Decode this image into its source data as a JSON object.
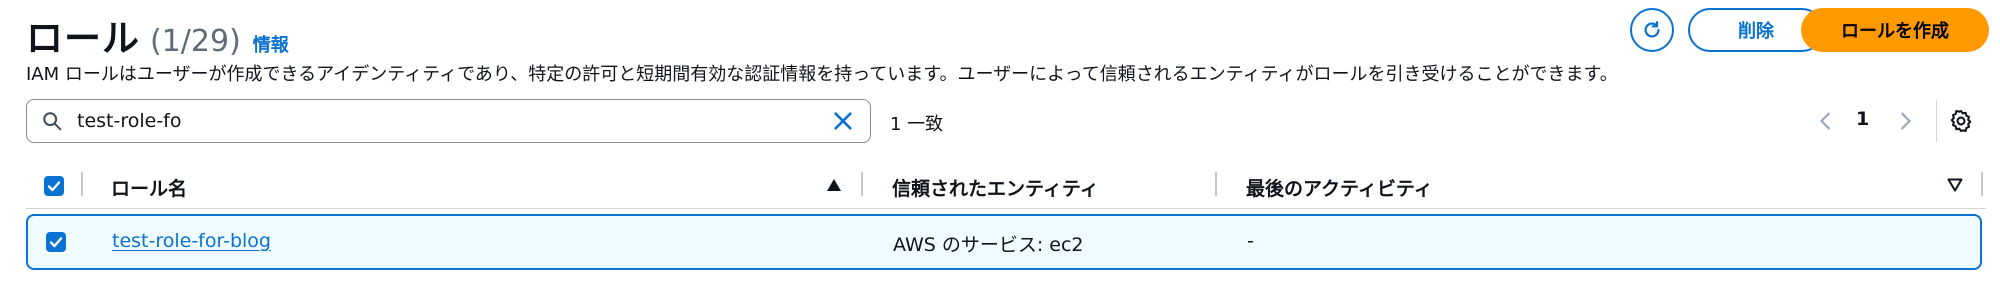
{
  "header": {
    "title": "ロール",
    "count": "(1/29)",
    "info_link": "情報",
    "description": "IAM ロールはユーザーが作成できるアイデンティティであり、特定の許可と短期間有効な認証情報を持っています。ユーザーによって信頼されるエンティティがロールを引き受けることができます。",
    "refresh_icon": "refresh-icon",
    "delete_label": "削除",
    "create_label": "ロールを作成"
  },
  "search": {
    "value": "test-role-fo",
    "placeholder": "",
    "match_count": "1 一致"
  },
  "pagination": {
    "current_page": "1"
  },
  "table": {
    "columns": [
      "ロール名",
      "信頼されたエンティティ",
      "最後のアクティビティ"
    ],
    "rows": [
      {
        "role_name": "test-role-for-blog",
        "trusted_entity": "AWS のサービス: ec2",
        "last_activity": "-"
      }
    ]
  },
  "colors": {
    "accent": "#0972d3",
    "primary_button": "#ff9900",
    "selected_row_bg": "#f0fbff"
  }
}
